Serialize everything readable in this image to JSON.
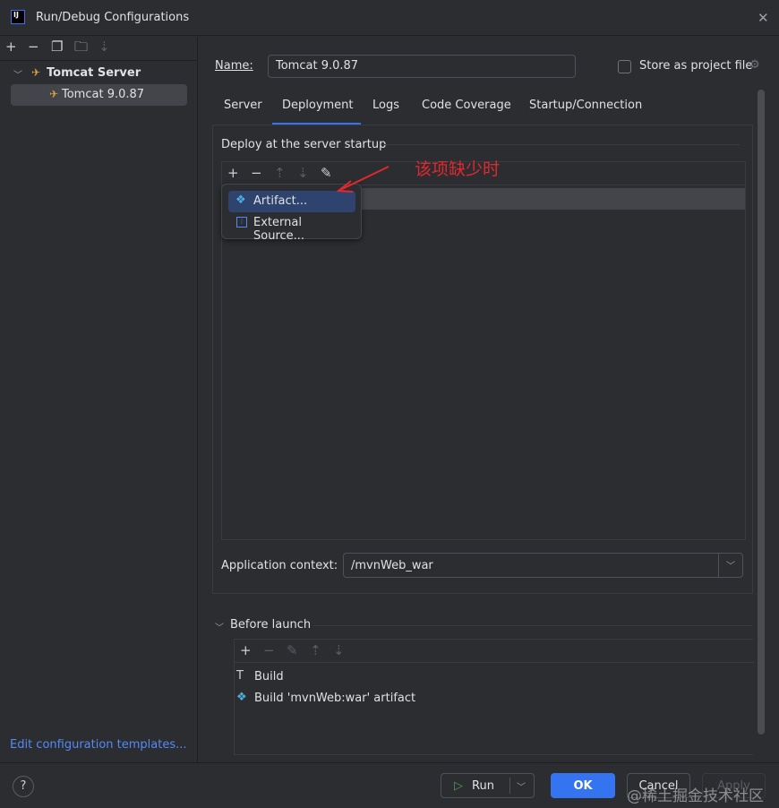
{
  "window": {
    "title": "Run/Debug Configurations",
    "logo": "IJ"
  },
  "tree": {
    "group": "Tomcat Server",
    "item": "Tomcat 9.0.87"
  },
  "edit_templates": "Edit configuration templates...",
  "name_label": "Name:",
  "name_value": "Tomcat 9.0.87",
  "store_label": "Store as project file",
  "store_checked": false,
  "tabs": [
    "Server",
    "Deployment",
    "Logs",
    "Code Coverage",
    "Startup/Connection"
  ],
  "active_tab": "Deployment",
  "deploy_title": "Deploy at the server startup",
  "popup": [
    "Artifact...",
    "External Source..."
  ],
  "annotation": "该项缺少时",
  "app_context_label": "Application context:",
  "app_context_value": "/mvnWeb_war",
  "before_launch": {
    "title": "Before launch",
    "items": [
      "Build",
      "Build 'mvnWeb:war' artifact"
    ]
  },
  "buttons": {
    "run": "Run",
    "ok": "OK",
    "cancel": "Cancel",
    "apply": "Apply"
  },
  "watermark": "@稀土掘金技术社区",
  "colors": {
    "accent": "#3574f0",
    "annotation": "#e0292f",
    "selection": "#2e436e"
  }
}
